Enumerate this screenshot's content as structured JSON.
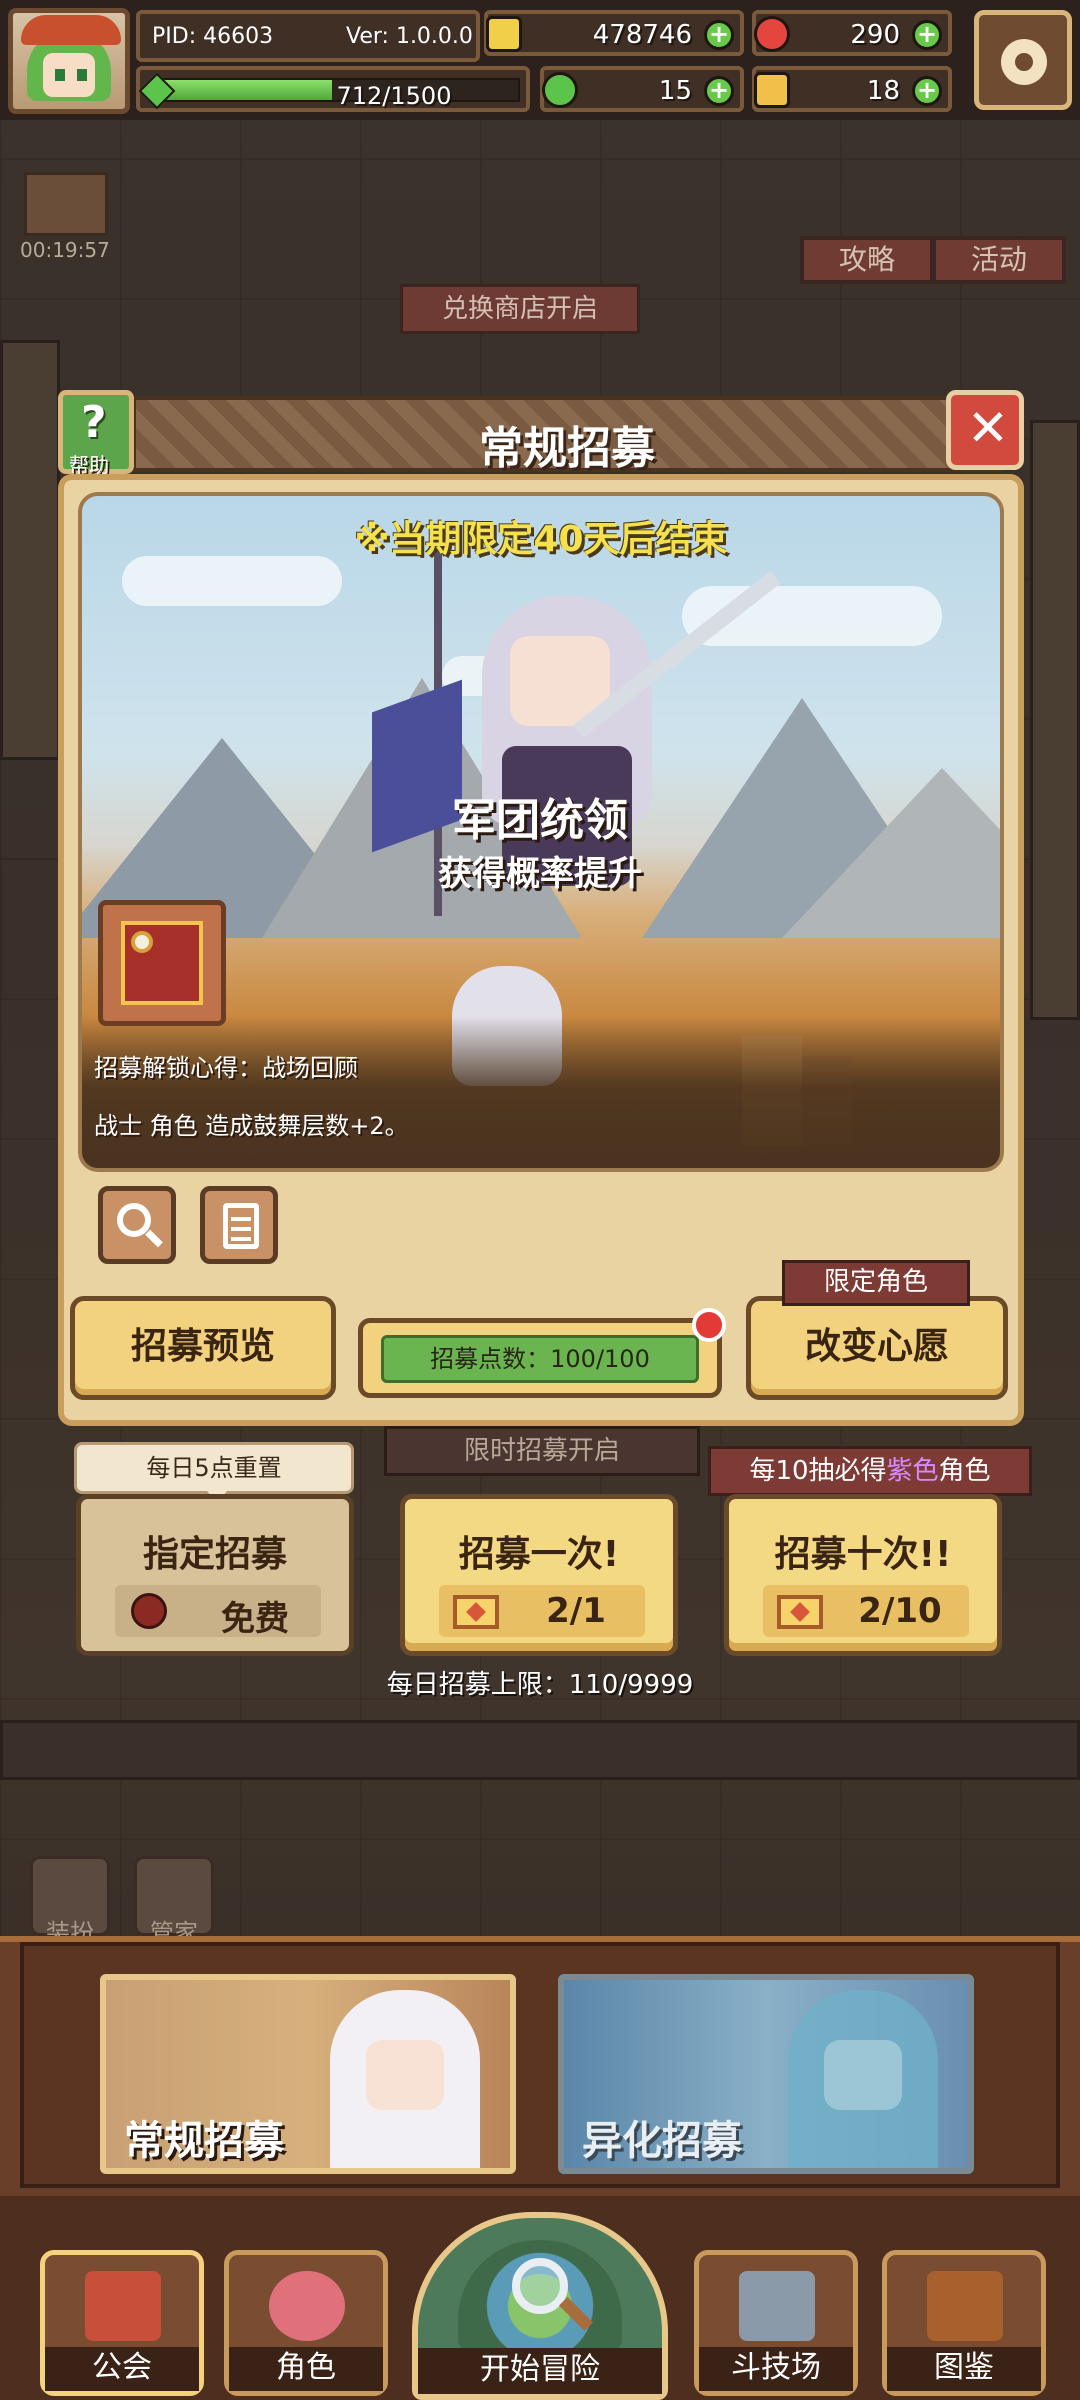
{
  "hud": {
    "pid": "PID: 46603",
    "version": "Ver: 1.0.0.0",
    "exp_text": "712/1500",
    "exp_fraction": 0.4747,
    "gold": "478746",
    "gems": "290",
    "clover": "15",
    "tickets": "18",
    "icons": {
      "gold": "gold-coin-icon",
      "gems": "red-gem-icon",
      "clover": "clover-icon",
      "tickets": "ticket-icon",
      "settings": "gear-icon"
    }
  },
  "background": {
    "timer": "00:19:57",
    "strategy": "攻略",
    "activity": "活动",
    "exchange_shop": "兑换商店开启",
    "limited_recruit": "限时招募开启",
    "dress_up": "装扮",
    "butler": "管家"
  },
  "modal": {
    "title": "常规招募",
    "help_label": "帮助",
    "banner_notice": "※当期限定40天后结束",
    "character_name": "军团统领",
    "rate_up": "获得概率提升",
    "unlock_text": "招募解锁心得：战场回顾",
    "unlock_desc": "战士 角色 造成鼓舞层数+2。",
    "preview_button": "招募预览",
    "points_label": "招募点数：100/100",
    "limited_tag": "限定角色",
    "change_wish_button": "改变心愿"
  },
  "draw": {
    "reset_tag": "每日5点重置",
    "designated_title": "指定招募",
    "designated_cost": "免费",
    "one_title": "招募一次!",
    "one_cost": "2/1",
    "ten_title": "招募十次!!",
    "ten_cost": "2/10",
    "ten_guarantee_pre": "每10抽必得",
    "ten_guarantee_purple": "紫色",
    "ten_guarantee_post": "角色",
    "daily_limit": "每日招募上限：110/9999"
  },
  "recruit_tabs": {
    "normal": "常规招募",
    "alien": "异化招募"
  },
  "nav": {
    "guild": "公会",
    "role": "角色",
    "adventure": "开始冒险",
    "arena": "斗技场",
    "codex": "图鉴"
  },
  "colors": {
    "accent_gold": "#f2d27e",
    "frame_brown": "#6b4a2a",
    "close_red": "#d24a3e",
    "help_green": "#5ca54a",
    "notice_yellow": "#f4e14c",
    "purple_highlight": "#d58bff"
  }
}
